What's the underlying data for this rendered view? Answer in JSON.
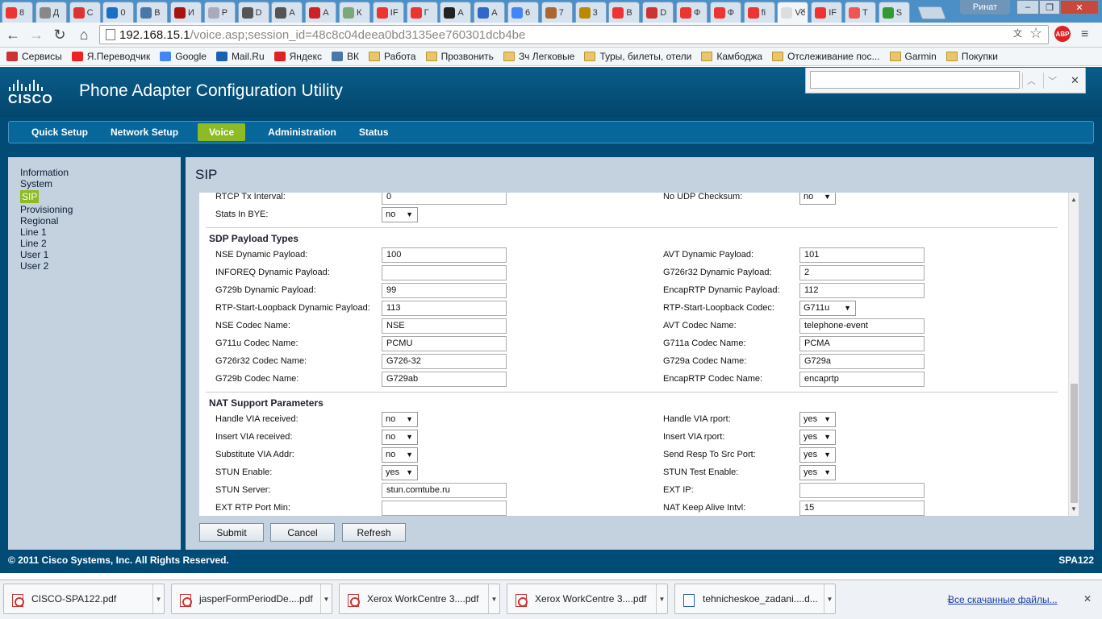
{
  "browser": {
    "tabs": [
      {
        "label": "8",
        "color": "#e33"
      },
      {
        "label": "Д",
        "color": "#888"
      },
      {
        "label": "С",
        "color": "#d33"
      },
      {
        "label": "0",
        "color": "#1a6fc4"
      },
      {
        "label": "В",
        "color": "#4a76a8"
      },
      {
        "label": "И",
        "color": "#a11"
      },
      {
        "label": "Р",
        "color": "#aab"
      },
      {
        "label": "D",
        "color": "#555"
      },
      {
        "label": "А",
        "color": "#555"
      },
      {
        "label": "А",
        "color": "#c22"
      },
      {
        "label": "К",
        "color": "#7a7"
      },
      {
        "label": "IF",
        "color": "#e33"
      },
      {
        "label": "Г",
        "color": "#e33"
      },
      {
        "label": "А",
        "color": "#222"
      },
      {
        "label": "А",
        "color": "#36c"
      },
      {
        "label": "6",
        "color": "#4285f4"
      },
      {
        "label": "7",
        "color": "#a63"
      },
      {
        "label": "3",
        "color": "#b80"
      },
      {
        "label": "В",
        "color": "#e33"
      },
      {
        "label": "D",
        "color": "#c33"
      },
      {
        "label": "Ф",
        "color": "#e33"
      },
      {
        "label": "Ф",
        "color": "#e33"
      },
      {
        "label": "fi",
        "color": "#e33"
      },
      {
        "label": "Vc",
        "color": "#ddd",
        "active": true
      },
      {
        "label": "IF",
        "color": "#e33"
      },
      {
        "label": "Т",
        "color": "#e55"
      },
      {
        "label": "S",
        "color": "#393"
      }
    ],
    "user": "Ринат",
    "url_host": "192.168.15.1",
    "url_path": "/voice.asp;session_id=48c8c04deea0bd3135ee760301dcb4be",
    "bookmarks": [
      {
        "label": "Сервисы",
        "icon": "apps-icon"
      },
      {
        "label": "Я.Переводчик",
        "icon": "translate-icon"
      },
      {
        "label": "Google",
        "icon": "google-icon"
      },
      {
        "label": "Mail.Ru",
        "icon": "mail-icon"
      },
      {
        "label": "Яндекс",
        "icon": "yandex-icon"
      },
      {
        "label": "ВК",
        "icon": "vk-icon"
      },
      {
        "label": "Работа",
        "icon": "folder-icon"
      },
      {
        "label": "Прозвонить",
        "icon": "folder-icon"
      },
      {
        "label": "Зч Легковые",
        "icon": "folder-icon"
      },
      {
        "label": "Туры, билеты, отели",
        "icon": "folder-icon"
      },
      {
        "label": "Камбоджа",
        "icon": "folder-icon"
      },
      {
        "label": "Отслеживание пос...",
        "icon": "folder-icon"
      },
      {
        "label": "Garmin",
        "icon": "folder-icon"
      },
      {
        "label": "Покупки",
        "icon": "folder-icon"
      }
    ],
    "find_value": ""
  },
  "app": {
    "logo_text": "CISCO",
    "title": "Phone Adapter Configuration Utility",
    "nav": [
      {
        "label": "Quick Setup"
      },
      {
        "label": "Network Setup"
      },
      {
        "label": "Voice",
        "active": true
      },
      {
        "label": "Administration"
      },
      {
        "label": "Status"
      }
    ],
    "sidebar": [
      "Information",
      "System",
      "SIP",
      "Provisioning",
      "Regional",
      "Line 1",
      "Line 2",
      "User 1",
      "User 2"
    ],
    "sidebar_active": "SIP",
    "page_title": "SIP",
    "top_rows": [
      {
        "l_label": "RTCP Tx Interval:",
        "l_value": "0",
        "l_type": "input",
        "r_label": "No UDP Checksum:",
        "r_value": "no",
        "r_type": "select"
      },
      {
        "l_label": "Stats In BYE:",
        "l_value": "no",
        "l_type": "select",
        "r_label": "",
        "r_value": "",
        "r_type": "none"
      }
    ],
    "sdp_title": "SDP Payload Types",
    "sdp_rows": [
      {
        "l_label": "NSE Dynamic Payload:",
        "l_value": "100",
        "l_type": "input",
        "r_label": "AVT Dynamic Payload:",
        "r_value": "101",
        "r_type": "input"
      },
      {
        "l_label": "INFOREQ Dynamic Payload:",
        "l_value": "",
        "l_type": "input",
        "r_label": "G726r32 Dynamic Payload:",
        "r_value": "2",
        "r_type": "input"
      },
      {
        "l_label": "G729b Dynamic Payload:",
        "l_value": "99",
        "l_type": "input",
        "r_label": "EncapRTP Dynamic Payload:",
        "r_value": "112",
        "r_type": "input"
      },
      {
        "l_label": "RTP-Start-Loopback Dynamic Payload:",
        "l_value": "113",
        "l_type": "input",
        "r_label": "RTP-Start-Loopback Codec:",
        "r_value": "G711u",
        "r_type": "select-wide"
      },
      {
        "l_label": "NSE Codec Name:",
        "l_value": "NSE",
        "l_type": "input",
        "r_label": "AVT Codec Name:",
        "r_value": "telephone-event",
        "r_type": "input"
      },
      {
        "l_label": "G711u Codec Name:",
        "l_value": "PCMU",
        "l_type": "input",
        "r_label": "G711a Codec Name:",
        "r_value": "PCMA",
        "r_type": "input"
      },
      {
        "l_label": "G726r32 Codec Name:",
        "l_value": "G726-32",
        "l_type": "input",
        "r_label": "G729a Codec Name:",
        "r_value": "G729a",
        "r_type": "input"
      },
      {
        "l_label": "G729b Codec Name:",
        "l_value": "G729ab",
        "l_type": "input",
        "r_label": "EncapRTP Codec Name:",
        "r_value": "encaprtp",
        "r_type": "input"
      }
    ],
    "nat_title": "NAT Support Parameters",
    "nat_rows": [
      {
        "l_label": "Handle VIA received:",
        "l_value": "no",
        "l_type": "select",
        "r_label": "Handle VIA rport:",
        "r_value": "yes",
        "r_type": "select"
      },
      {
        "l_label": "Insert VIA received:",
        "l_value": "no",
        "l_type": "select",
        "r_label": "Insert VIA rport:",
        "r_value": "yes",
        "r_type": "select"
      },
      {
        "l_label": "Substitute VIA Addr:",
        "l_value": "no",
        "l_type": "select",
        "r_label": "Send Resp To Src Port:",
        "r_value": "yes",
        "r_type": "select"
      },
      {
        "l_label": "STUN Enable:",
        "l_value": "yes",
        "l_type": "select",
        "r_label": "STUN Test Enable:",
        "r_value": "yes",
        "r_type": "select"
      },
      {
        "l_label": "STUN Server:",
        "l_value": "stun.comtube.ru",
        "l_type": "input",
        "r_label": "EXT IP:",
        "r_value": "",
        "r_type": "input"
      },
      {
        "l_label": "EXT RTP Port Min:",
        "l_value": "",
        "l_type": "input",
        "r_label": "NAT Keep Alive Intvl:",
        "r_value": "15",
        "r_type": "input"
      }
    ],
    "buttons": {
      "submit": "Submit",
      "cancel": "Cancel",
      "refresh": "Refresh"
    },
    "copyright": "© 2011 Cisco Systems, Inc. All Rights Reserved.",
    "model": "SPA122"
  },
  "downloads": {
    "items": [
      {
        "name": "CISCO-SPA122.pdf",
        "type": "pdf"
      },
      {
        "name": "jasperFormPeriodDe....pdf",
        "type": "pdf"
      },
      {
        "name": "Xerox WorkCentre 3....pdf",
        "type": "pdf"
      },
      {
        "name": "Xerox WorkCentre 3....pdf",
        "type": "pdf"
      },
      {
        "name": "tehnicheskoe_zadani....d...",
        "type": "doc"
      }
    ],
    "all_label": "Все скачанные файлы..."
  }
}
